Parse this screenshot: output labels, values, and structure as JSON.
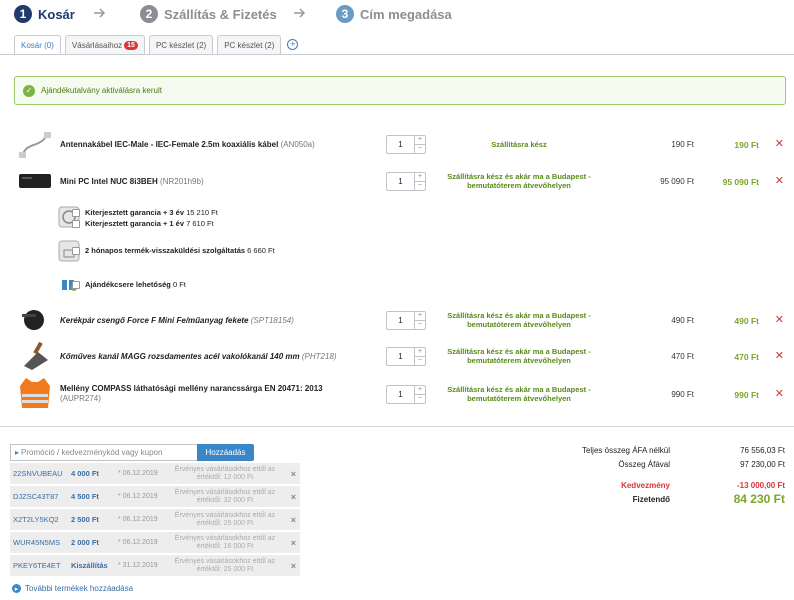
{
  "steps": [
    {
      "num": "1",
      "label": "Kosár"
    },
    {
      "num": "2",
      "label": "Szállítás & Fizetés"
    },
    {
      "num": "3",
      "label": "Cím megadása"
    }
  ],
  "tabs": [
    {
      "label": "Kosár (0)"
    },
    {
      "label": "Vásárlásaihoz",
      "badge": "15"
    },
    {
      "label": "PC készlet (2)"
    },
    {
      "label": "PC készlet (2)"
    }
  ],
  "tab_add": "+",
  "alert": {
    "icon": "✓",
    "text": "Ajándékutalvány aktiválásra kerult"
  },
  "items": [
    {
      "name": "Antennakábel IEC-Male - IEC-Female 2.5m koaxiális kábel",
      "sku": "(AN050a)",
      "qty": "1",
      "status": "Szállításra kész",
      "unit": "190 Ft",
      "total": "190 Ft",
      "icon": "antenna-cable-image"
    },
    {
      "name": "Mini PC Intel NUC 8i3BEH",
      "sku": "(NR201h9b)",
      "qty": "1",
      "status": "Szállításra kész és akár ma a Budapest - bemutatóterem átvevőhelyen",
      "unit": "95 090 Ft",
      "total": "95 090 Ft",
      "icon": "mini-pc-image"
    },
    {
      "name": "Kerékpár csengő Force F Mini Fe/műanyag fekete",
      "sku": "(SPT18154)",
      "qty": "1",
      "status": "Szállításra kész és akár ma a Budapest - bemutatóterem átvevőhelyen",
      "unit": "490 Ft",
      "total": "490 Ft",
      "icon": "bike-bell-image"
    },
    {
      "name": "Kőműves kanál MAGG rozsdamentes acél vakolókanál 140 mm",
      "sku": "(PHT218)",
      "qty": "1",
      "status": "Szállításra kész és akár ma a Budapest - bemutatóterem átvevőhelyen",
      "unit": "470 Ft",
      "total": "470 Ft",
      "icon": "trowel-image"
    },
    {
      "name": "Mellény COMPASS láthatósági mellény narancssárga EN 20471: 2013",
      "sku": "(AUPR274)",
      "qty": "1",
      "status": "Szállításra kész és akár ma a Budapest - bemutatóterem átvevőhelyen",
      "unit": "990 Ft",
      "total": "990 Ft",
      "icon": "safety-vest-image"
    }
  ],
  "options": {
    "warranty": [
      {
        "label": "Kiterjesztett garancia + 3 év",
        "price": "15 210 Ft"
      },
      {
        "label": "Kiterjesztett garancia + 1 év",
        "price": "7 610 Ft"
      }
    ],
    "return": {
      "label": "2 hónapos termék-visszaküldési szolgáltatás",
      "price": "6 660 Ft"
    },
    "gift": {
      "label": "Ajándékcsere lehetőség",
      "price": "0 Ft"
    }
  },
  "promo": {
    "placeholder": "Promóció / kedvezménykód vagy kupon",
    "button": "Hozzáadás",
    "icon": "▸"
  },
  "coupons": [
    {
      "code": "22SNVUBEAU",
      "amount": "4 000 Ft",
      "date": "* 06.12.2019",
      "cond": "Érvényes vásárlásokhoz ettől az értéktől: 12 000 Ft"
    },
    {
      "code": "DJZSC43T87",
      "amount": "4 500 Ft",
      "date": "* 06.12.2019",
      "cond": "Érvényes vásárlásokhoz ettől az értéktől: 32 000 Ft"
    },
    {
      "code": "X2T2LY5KQ2",
      "amount": "2 500 Ft",
      "date": "* 06.12.2019",
      "cond": "Érvényes vásárlásokhoz ettől az értéktől: 25 000 Ft"
    },
    {
      "code": "WUR45N5MS",
      "amount": "2 000 Ft",
      "date": "* 06.12.2019",
      "cond": "Érvényes vásárlásokhoz ettől az értéktől: 16 000 Ft"
    },
    {
      "code": "PKEY6TE4ET",
      "amount": "Kiszállítás",
      "date": "* 31.12.2019",
      "cond": "Érvényes vásárlásokhoz ettől az értéktől: 25 000 Ft"
    }
  ],
  "coupon_remove": "×",
  "summary": {
    "net_label": "Teljes összeg ÁFA nélkül",
    "net": "76 556,03 Ft",
    "vat_label": "Összeg Áfával",
    "vat": "97 230,00 Ft",
    "discount_label": "Kedvezmény",
    "discount": "-13 000,00 Ft",
    "pay_label": "Fizetendő",
    "pay": "84 230 Ft"
  },
  "more": {
    "icon": "▸",
    "text": "További termékek hozzáadása"
  },
  "colors": {
    "accent": "#3a87c8",
    "price": "#7aa62a",
    "danger": "#d9343a",
    "status": "#5a8a1a"
  }
}
